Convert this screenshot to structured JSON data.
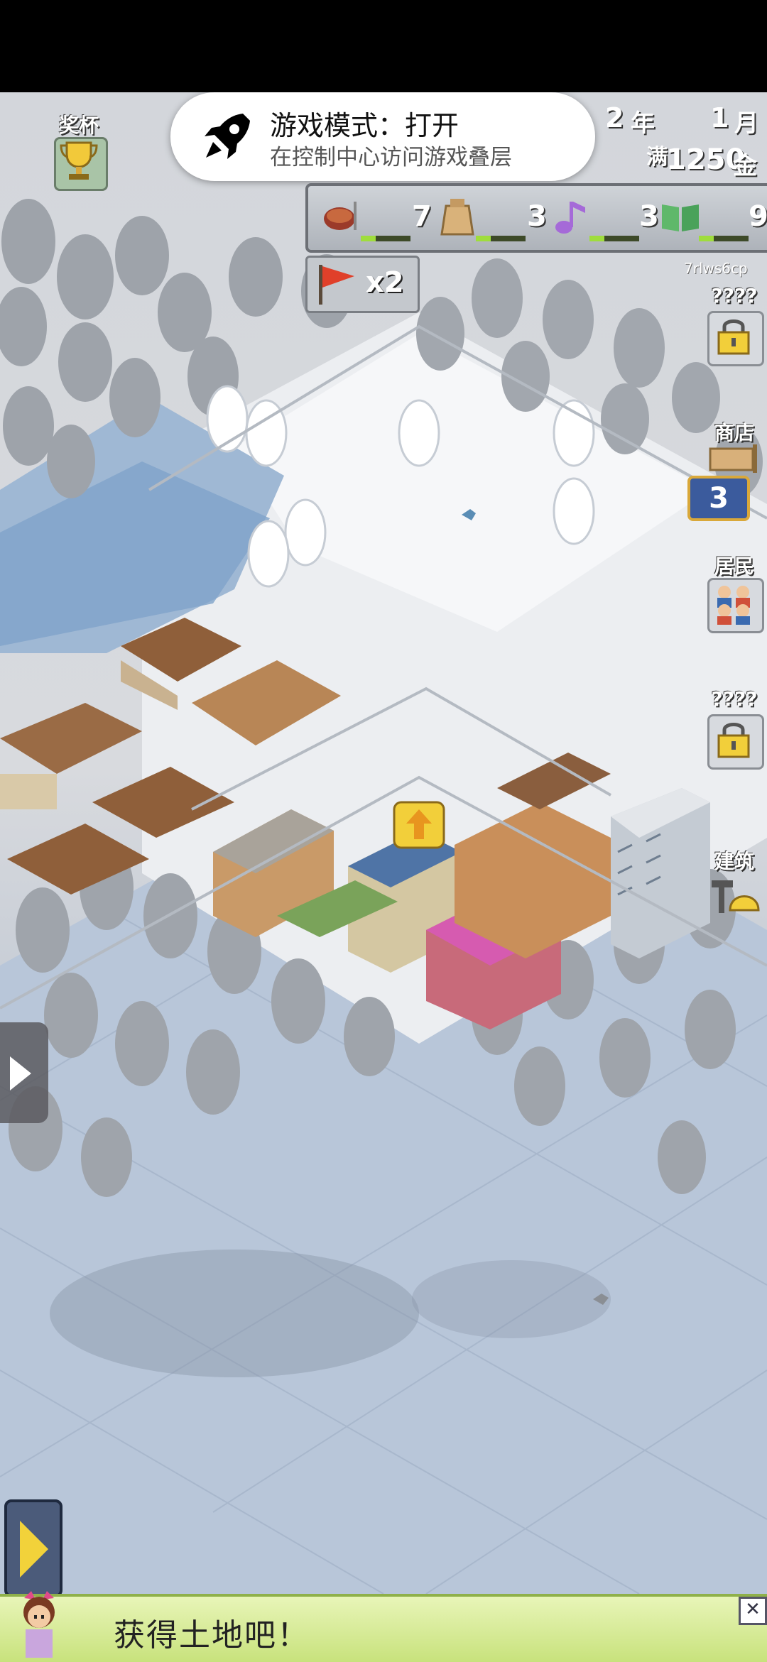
{
  "toast": {
    "title": "游戏模式：打开",
    "subtitle": "在控制中心访问游戏叠层",
    "icon": "rocket-icon"
  },
  "trophy": {
    "label": "奖杯",
    "icon": "trophy-icon"
  },
  "date": {
    "year": "2",
    "year_label": "年",
    "month": "1",
    "month_label": "月"
  },
  "money": {
    "full_label": "满",
    "amount": "1250",
    "unit": "金"
  },
  "resources": [
    {
      "name": "food",
      "icon": "food-icon",
      "value": "7"
    },
    {
      "name": "materials",
      "icon": "bag-icon",
      "value": "3"
    },
    {
      "name": "music",
      "icon": "music-note-icon",
      "value": "3"
    },
    {
      "name": "knowledge",
      "icon": "book-icon",
      "value": "9"
    }
  ],
  "flag": {
    "icon": "flag-icon",
    "multiplier": "x2"
  },
  "code_text": "7rlws6cp",
  "side_menu": {
    "locked_top": "????",
    "shop": "商店",
    "shop_count": "3",
    "residents": "居民",
    "locked_mid": "????",
    "build": "建筑"
  },
  "dialog": {
    "message": "获得土地吧！",
    "close": "✕"
  },
  "colors": {
    "toast_bg": "#ffffff",
    "dialog_bg": "#d9eb9a",
    "snow": "#eef0f3",
    "water": "#b7c7dc",
    "accent_gold": "#f2d23a"
  }
}
